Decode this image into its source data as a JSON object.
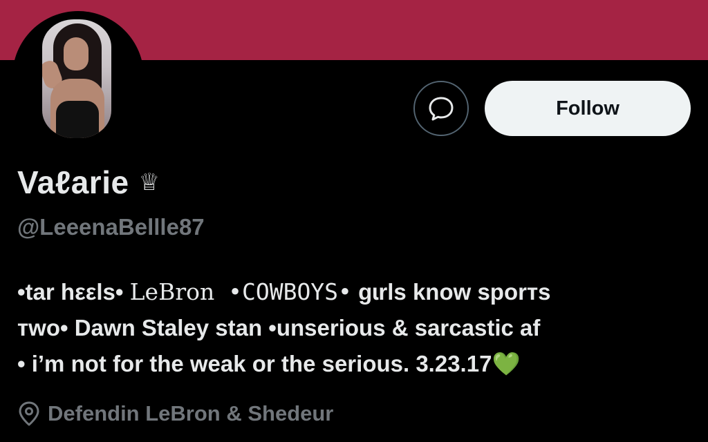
{
  "banner": {
    "color": "#a52344"
  },
  "profile": {
    "name": "Vaℓarie",
    "badge_icon": "♕",
    "handle": "@LeeenaBellle87",
    "bio": {
      "line1_a": "•tar hεεls• ",
      "line1_b": "LeBron",
      "line1_c": " •COWBOYS•",
      "line1_d": " gɩrls know sporтs",
      "line2": "тwo• Dawn Staley stan •unserious & sarcastic af",
      "line3": "• i’m not for the weak or the serious. 3.23.17",
      "heart": "💚"
    },
    "location": "Defendin LeBron & Shedeur"
  },
  "actions": {
    "message_icon": "message-icon",
    "follow_label": "Follow"
  },
  "colors": {
    "background": "#000000",
    "primary_text": "#e7e9ea",
    "secondary_text": "#71767b",
    "follow_bg": "#eff3f4"
  }
}
